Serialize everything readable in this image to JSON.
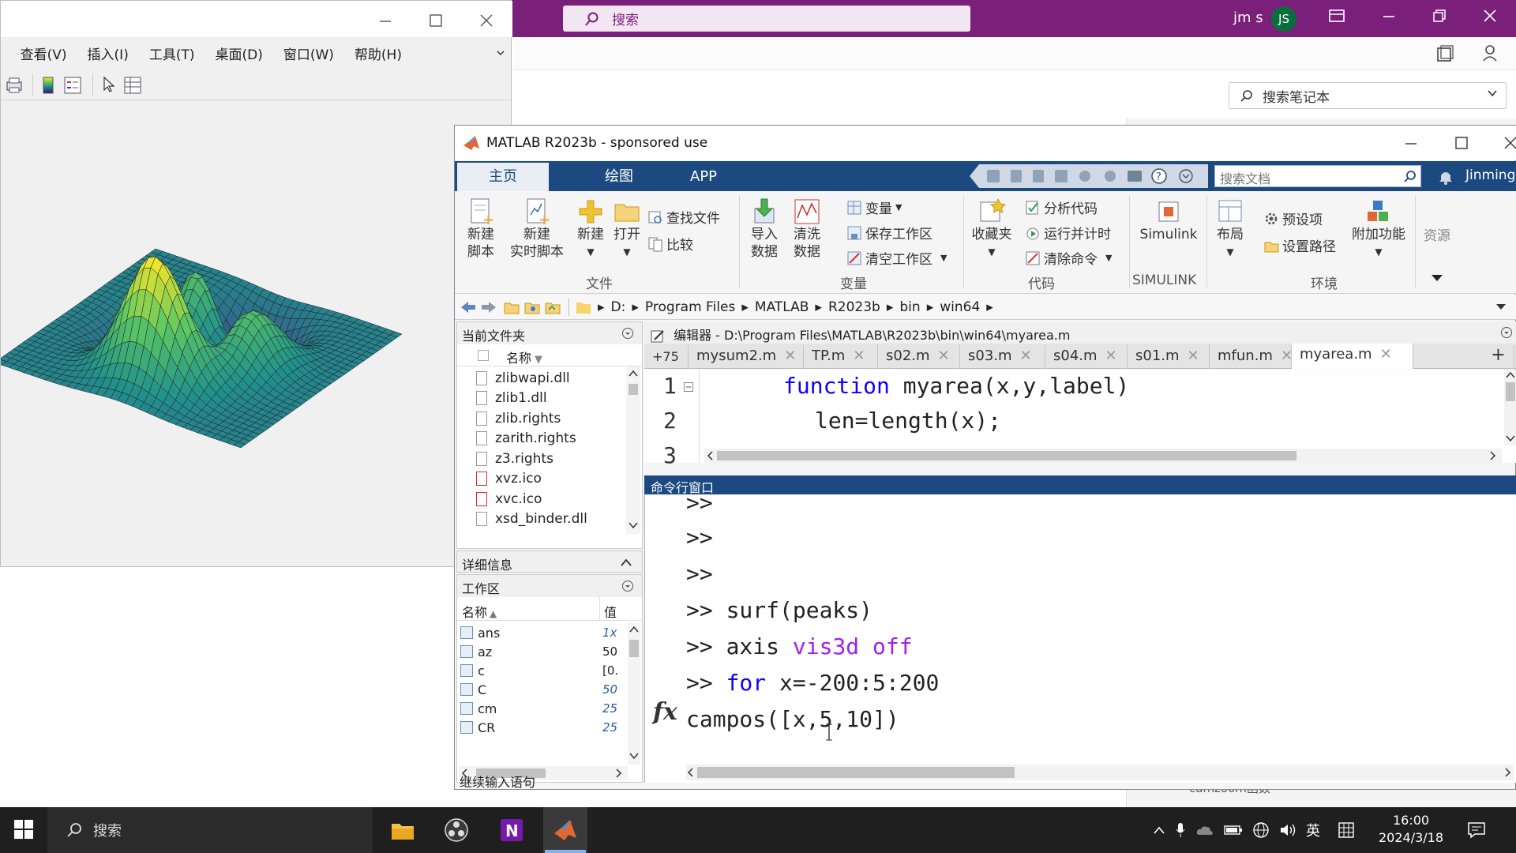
{
  "onenote": {
    "search_placeholder": "搜索",
    "user": "jm s",
    "avatar_initials": "JS",
    "notebook_search": "搜索笔记本",
    "bottom_item": "camzoom函数"
  },
  "figure": {
    "menu": [
      "查看(V)",
      "插入(I)",
      "工具(T)",
      "桌面(D)",
      "窗口(W)",
      "帮助(H)"
    ]
  },
  "matlab": {
    "title": "MATLAB R2023b - sponsored use",
    "tabs": {
      "home": "主页",
      "plots": "绘图",
      "apps": "APP"
    },
    "doc_search_placeholder": "搜索文档",
    "user": "Jinming",
    "ribbon": {
      "new_script": [
        "新建",
        "脚本"
      ],
      "new_live_script": [
        "新建",
        "实时脚本"
      ],
      "new": "新建",
      "open": "打开",
      "find_files": "查找文件",
      "compare": "比较",
      "import_data": [
        "导入",
        "数据"
      ],
      "clean_data": [
        "清洗",
        "数据"
      ],
      "variable": "变量",
      "save_workspace": "保存工作区",
      "clear_workspace": "清空工作区",
      "favorites": "收藏夹",
      "analyze_code": "分析代码",
      "run_and_time": "运行并计时",
      "clear_commands": "清除命令",
      "simulink": "Simulink",
      "layout": "布局",
      "preferences": "预设项",
      "set_path": "设置路径",
      "addons": "附加功能",
      "resources": "资源",
      "groups": {
        "file": "文件",
        "variable": "变量",
        "code": "代码",
        "simulink": "SIMULINK",
        "environment": "环境"
      }
    },
    "address": [
      "D:",
      "Program Files",
      "MATLAB",
      "R2023b",
      "bin",
      "win64"
    ],
    "current_folder": {
      "title": "当前文件夹",
      "column": "名称",
      "files": [
        "zlibwapi.dll",
        "zlib1.dll",
        "zlib.rights",
        "zarith.rights",
        "z3.rights",
        "xvz.ico",
        "xvc.ico",
        "xsd_binder.dll"
      ]
    },
    "details_title": "详细信息",
    "workspace": {
      "title": "工作区",
      "col_name": "名称",
      "col_value": "值",
      "vars": [
        {
          "name": "ans",
          "value": "1x"
        },
        {
          "name": "az",
          "value": "50"
        },
        {
          "name": "c",
          "value": "[0."
        },
        {
          "name": "C",
          "value": "50"
        },
        {
          "name": "cm",
          "value": "25"
        },
        {
          "name": "CR",
          "value": "25"
        }
      ]
    },
    "editor": {
      "title": "编辑器 - D:\\Program Files\\MATLAB\\R2023b\\bin\\win64\\myarea.m",
      "overflow": "+75",
      "tabs": [
        "mysum2.m",
        "TP.m",
        "s02.m",
        "s03.m",
        "s04.m",
        "s01.m",
        "mfun.m",
        "myarea.m"
      ],
      "add_tab": "+",
      "line_numbers": [
        "1",
        "2",
        "3"
      ],
      "line1_kw": "function",
      "line1_rest": " myarea(x,y,label)",
      "line2": "len=length(x);"
    },
    "command_window": {
      "title": "命令行窗口",
      "prompt": ">>",
      "line_surf": ">> surf(peaks)",
      "line_axis_cmd": ">> axis ",
      "line_axis_args": "vis3d off",
      "line_for_prompt": ">> ",
      "line_for_kw": "for",
      "line_for_rest": " x=-200:5:200",
      "current_input": "campos([x,5,10])"
    },
    "status": "继续输入语句"
  },
  "taskbar": {
    "search": "搜索",
    "ime": "英",
    "time": "16:00",
    "date": "2024/3/18"
  }
}
